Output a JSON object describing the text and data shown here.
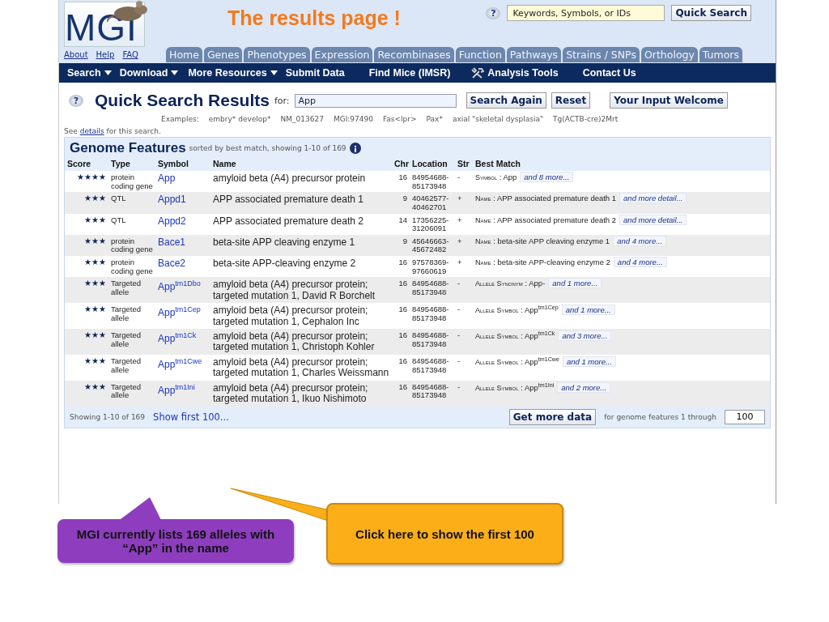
{
  "header": {
    "logo": "MGI",
    "links": [
      "About",
      "Help",
      "FAQ"
    ],
    "slide_title": "The results page !",
    "help_icon": "?",
    "search": {
      "placeholder": "Keywords, Symbols, or IDs"
    },
    "search_button": "Quick Search"
  },
  "tabs": [
    "Home",
    "Genes",
    "Phenotypes",
    "Expression",
    "Recombinases",
    "Function",
    "Pathways",
    "Strains / SNPs",
    "Orthology",
    "Tumors"
  ],
  "menu": [
    {
      "label": "Search",
      "kind": "dropdown"
    },
    {
      "label": "Download",
      "kind": "dropdown"
    },
    {
      "label": "More Resources",
      "kind": "dropdown"
    },
    {
      "label": "Submit Data",
      "kind": "plain"
    },
    {
      "label": "Find Mice (IMSR)",
      "kind": "plain"
    },
    {
      "label": "Analysis Tools",
      "kind": "tools"
    },
    {
      "label": "Contact Us",
      "kind": "plain"
    }
  ],
  "query": {
    "help_icon": "?",
    "title": "Quick Search Results",
    "for_label": "for:",
    "value": "App",
    "buttons": [
      "Search Again",
      "Reset",
      "Your Input Welcome"
    ],
    "examples_label": "Examples:",
    "examples": [
      "embry* develop*",
      "NM_013627",
      "MGI:97490",
      "Fas<lpr>",
      "Pax*",
      "axial \"skeletal dysplasia\"",
      "Tg(ACTB-cre)2Mrt"
    ],
    "note_pre": "See",
    "note_link": "details",
    "note_post": "for this search."
  },
  "genome": {
    "title": "Genome Features",
    "subtitle": "sorted by best match, showing 1-10 of 169",
    "columns": [
      "Score",
      "Type",
      "Symbol",
      "Name",
      "Chr",
      "Location",
      "Str",
      "Best Match"
    ],
    "rows": [
      {
        "stars": 4,
        "type": "protein coding gene",
        "symbol": "App",
        "name": "amyloid beta (A4) precursor protein",
        "chr": "16",
        "location": "84954688-85173948",
        "str": "-",
        "match_label": "Symbol",
        "match_value": ": App",
        "more": "and 8 more..."
      },
      {
        "stars": 3,
        "type": "QTL",
        "symbol": "Appd1",
        "name": "APP associated premature death 1",
        "chr": "9",
        "location": "40462577-40462701",
        "str": "+",
        "match_label": "Name",
        "match_value": ": APP associated premature death 1",
        "more": "and more detail..."
      },
      {
        "stars": 3,
        "type": "QTL",
        "symbol": "Appd2",
        "name": "APP associated premature death 2",
        "chr": "14",
        "location": "17356225-31206091",
        "str": "+",
        "match_label": "Name",
        "match_value": ": APP associated premature death 2",
        "more": "and more detail..."
      },
      {
        "stars": 3,
        "type": "protein coding gene",
        "symbol": "Bace1",
        "name": "beta-site APP cleaving enzyme 1",
        "chr": "9",
        "location": "45646663-45672482",
        "str": "+",
        "match_label": "Name",
        "match_value": ": beta-site APP cleaving enzyme 1",
        "more": "and 4 more..."
      },
      {
        "stars": 3,
        "type": "protein coding gene",
        "symbol": "Bace2",
        "name": "beta-site APP-cleaving enzyme 2",
        "chr": "16",
        "location": "97578369-97660619",
        "str": "+",
        "match_label": "Name",
        "match_value": ": beta-site APP-cleaving enzyme 2",
        "more": "and 4 more..."
      },
      {
        "stars": 3,
        "type": "Targeted allele",
        "symbol": "App$^{tm1Dbo}$",
        "name": "amyloid beta (A4) precursor protein; targeted mutation 1, David R Borchelt",
        "chr": "16",
        "location": "84954688-85173948",
        "str": "-",
        "match_label": "Allele Synonym",
        "match_value": ": App-",
        "more": "and 1 more..."
      },
      {
        "stars": 3,
        "type": "Targeted allele",
        "symbol": "App$^{tm1Cep}$",
        "name": "amyloid beta (A4) precursor protein; targeted mutation 1, Cephalon Inc",
        "chr": "16",
        "location": "84954688-85173948",
        "str": "-",
        "match_label": "Allele Symbol",
        "match_value": ": App$^{tm1Cep}$",
        "more": "and 1 more..."
      },
      {
        "stars": 3,
        "type": "Targeted allele",
        "symbol": "App$^{tm1Ck}$",
        "name": "amyloid beta (A4) precursor protein; targeted mutation 1, Christoph Kohler",
        "chr": "16",
        "location": "84954688-85173948",
        "str": "-",
        "match_label": "Allele Symbol",
        "match_value": ": App$^{tm1Ck}$",
        "more": "and 3 more..."
      },
      {
        "stars": 3,
        "type": "Targeted allele",
        "symbol": "App$^{tm1Cwe}$",
        "name": "amyloid beta (A4) precursor protein; targeted mutation 1, Charles Weissmann",
        "chr": "16",
        "location": "84954688-85173948",
        "str": "-",
        "match_label": "Allele Symbol",
        "match_value": ": App$^{tm1Cwe}$",
        "more": "and 1 more..."
      },
      {
        "stars": 3,
        "type": "Targeted allele",
        "symbol": "App$^{tm1Ini}$",
        "name": "amyloid beta (A4) precursor protein; targeted mutation 1, Ikuo Nishimoto",
        "chr": "16",
        "location": "84954688-85173948",
        "str": "-",
        "match_label": "Allele Symbol",
        "match_value": ": App$^{tm1Ini}$",
        "more": "and 2 more..."
      }
    ],
    "footer": {
      "showing": "Showing 1-10 of 169",
      "link": "Show first 100...",
      "button": "Get more data",
      "range_label": "for genome features 1 through",
      "range_value": "100"
    }
  },
  "callouts": [
    {
      "text": "MGI currently lists 169 alleles with “App” in the name",
      "color": "#8e3dbf"
    },
    {
      "text": "Click here to show the first 100",
      "color": "#fbae17"
    }
  ]
}
